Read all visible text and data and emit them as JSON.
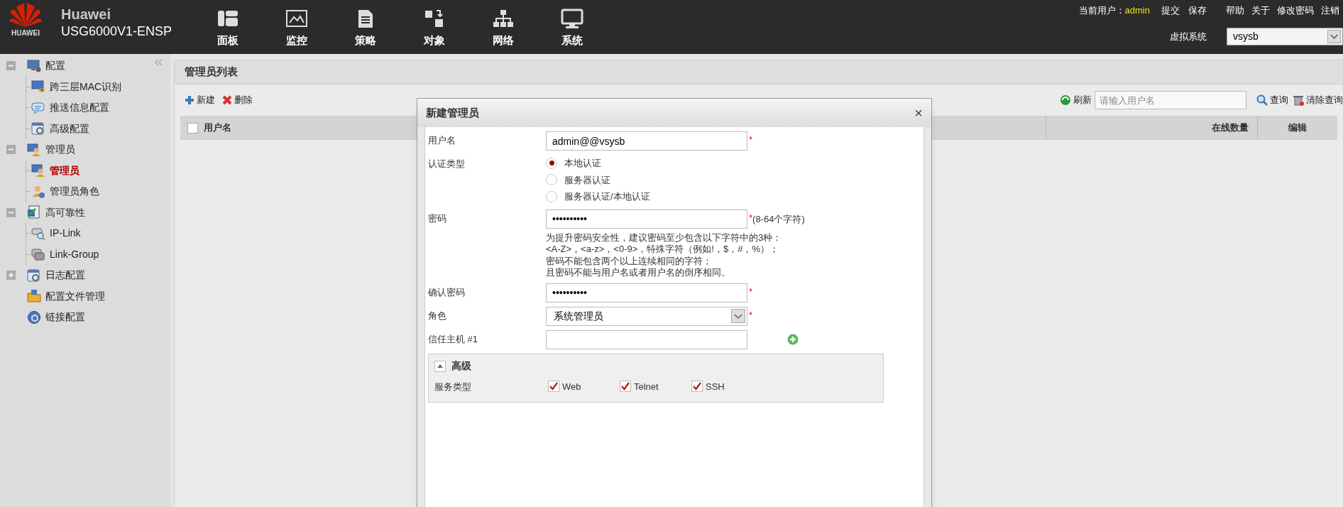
{
  "header": {
    "logo_text": "HUAWEI",
    "brand": "Huawei",
    "model": "USG6000V1-ENSP",
    "nav": [
      {
        "label": "面板",
        "kind": "dashboard"
      },
      {
        "label": "监控",
        "kind": "monitor"
      },
      {
        "label": "策略",
        "kind": "policy"
      },
      {
        "label": "对象",
        "kind": "object"
      },
      {
        "label": "网络",
        "kind": "network"
      },
      {
        "label": "系统",
        "kind": "system"
      }
    ],
    "user_label": "当前用户：",
    "user": "admin",
    "actions": [
      "提交",
      "保存"
    ],
    "links": [
      "帮助",
      "关于",
      "修改密码",
      "注销"
    ],
    "vsys_label": "虚拟系统",
    "vsys_value": "vsysb"
  },
  "sidebar": {
    "items": [
      {
        "label": "配置",
        "kind": "group",
        "expanded": true,
        "selected": false,
        "children": [
          {
            "label": "跨三层MAC识别",
            "selected": false
          },
          {
            "label": "推送信息配置",
            "selected": false
          },
          {
            "label": "高级配置",
            "selected": false
          }
        ]
      },
      {
        "label": "管理员",
        "kind": "group",
        "expanded": true,
        "selected": false,
        "children": [
          {
            "label": "管理员",
            "selected": true
          },
          {
            "label": "管理员角色",
            "selected": false
          }
        ]
      },
      {
        "label": "高可靠性",
        "kind": "group",
        "expanded": true,
        "selected": false,
        "children": [
          {
            "label": "IP-Link",
            "selected": false
          },
          {
            "label": "Link-Group",
            "selected": false
          }
        ]
      },
      {
        "label": "日志配置",
        "kind": "group",
        "expanded": false,
        "selected": false
      },
      {
        "label": "配置文件管理",
        "kind": "leaf",
        "selected": false
      },
      {
        "label": "链接配置",
        "kind": "leaf",
        "selected": false
      }
    ]
  },
  "main": {
    "title": "管理员列表",
    "select_all_checked": false,
    "new": "新建",
    "delete": "删除",
    "refresh": "刷新",
    "search_placeholder": "请输入用户名",
    "query": "查询",
    "clear": "清除查询",
    "columns": [
      "用户名",
      "在线数量",
      "编辑"
    ]
  },
  "dialog": {
    "title": "新建管理员",
    "close": "×",
    "fields": [
      {
        "kind": "text",
        "label": "用户名",
        "value": "admin@@vsysb",
        "mark": "*"
      },
      {
        "kind": "radio",
        "label": "认证类型",
        "options": [
          {
            "label": "本地认证",
            "selected": true
          },
          {
            "label": "服务器认证",
            "selected": false
          },
          {
            "label": "服务器认证/本地认证",
            "selected": false
          }
        ]
      },
      {
        "kind": "text",
        "label": "密码",
        "value": "••••••••••",
        "mark": "*",
        "note": "(8-64个字符)",
        "hint": [
          "为提升密码安全性，建议密码至少包含以下字符中的3种：",
          "<A-Z>，<a-z>，<0-9>，特殊字符（例如!，$，#，%）；",
          "密码不能包含两个以上连续相同的字符；",
          "且密码不能与用户名或者用户名的倒序相同。"
        ]
      },
      {
        "kind": "text",
        "label": "确认密码",
        "value": "••••••••••",
        "mark": "*"
      },
      {
        "kind": "select",
        "label": "角色",
        "value": "系统管理员",
        "mark": "*"
      },
      {
        "kind": "host",
        "label": "信任主机 #1"
      }
    ],
    "advanced": {
      "title": "高级",
      "expanded": true,
      "label": "服务类型",
      "options": [
        {
          "label": "Web",
          "checked": true
        },
        {
          "label": "Telnet",
          "checked": true
        },
        {
          "label": "SSH",
          "checked": true
        }
      ]
    }
  }
}
